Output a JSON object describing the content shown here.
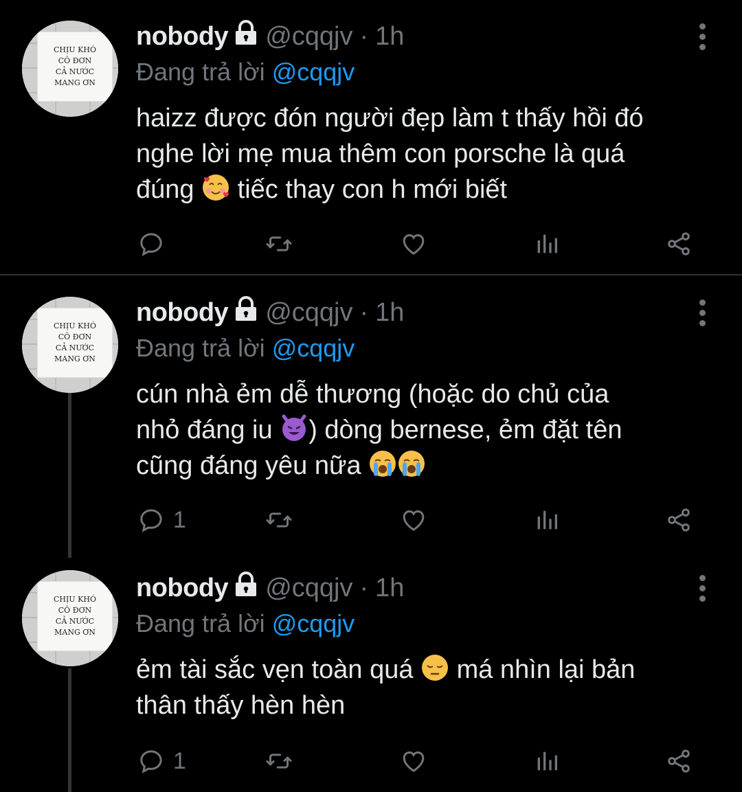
{
  "tweets": [
    {
      "name": "nobody",
      "handle": "@cqqjv",
      "time": "1h",
      "replying_prefix": "Đang trả lời ",
      "replying_to": "@cqqjv",
      "avatar_text": [
        "CHỊU KHÓ",
        "CÔ ĐƠN",
        "CẢ NƯỚC",
        "MANG ƠN"
      ],
      "text_lines": [
        "haizz được đón người đẹp làm t thấy hồi đó",
        "nghe lời mẹ mua thêm con porsche là quá",
        "đúng ",
        " tiếc thay con h mới biết"
      ],
      "reply_count": "",
      "emoji_1": "smiling-face-with-hearts"
    },
    {
      "name": "nobody",
      "handle": "@cqqjv",
      "time": "1h",
      "replying_prefix": "Đang trả lời ",
      "replying_to": "@cqqjv",
      "avatar_text": [
        "CHỊU KHÓ",
        "CÔ ĐƠN",
        "CẢ NƯỚC",
        "MANG ƠN"
      ],
      "text_lines": [
        "cún nhà ẻm dễ thương (hoặc do chủ của",
        "nhỏ đáng iu ",
        ") dòng bernese, ẻm đặt tên",
        "cũng đáng yêu nữa "
      ],
      "reply_count": "1",
      "emoji_1": "smiling-face-with-horns",
      "emoji_2": "loudly-crying-face"
    },
    {
      "name": "nobody",
      "handle": "@cqqjv",
      "time": "1h",
      "replying_prefix": "Đang trả lời ",
      "replying_to": "@cqqjv",
      "avatar_text": [
        "CHỊU KHÓ",
        "CÔ ĐƠN",
        "CẢ NƯỚC",
        "MANG ƠN"
      ],
      "text_lines": [
        "ẻm tài sắc vẹn toàn quá ",
        " má nhìn lại bản",
        "thân thấy hèn hèn"
      ],
      "reply_count": "1",
      "emoji_1": "pensive-face"
    }
  ],
  "icons": {
    "lock": "lock-icon",
    "more": "more-vertical-icon",
    "reply": "reply-icon",
    "retweet": "retweet-icon",
    "like": "heart-icon",
    "views": "views-icon",
    "share": "share-icon"
  },
  "colors": {
    "background": "#000000",
    "text": "#e7e9ea",
    "muted": "#71767b",
    "link": "#1d9bf0",
    "divider": "#2f3336"
  }
}
